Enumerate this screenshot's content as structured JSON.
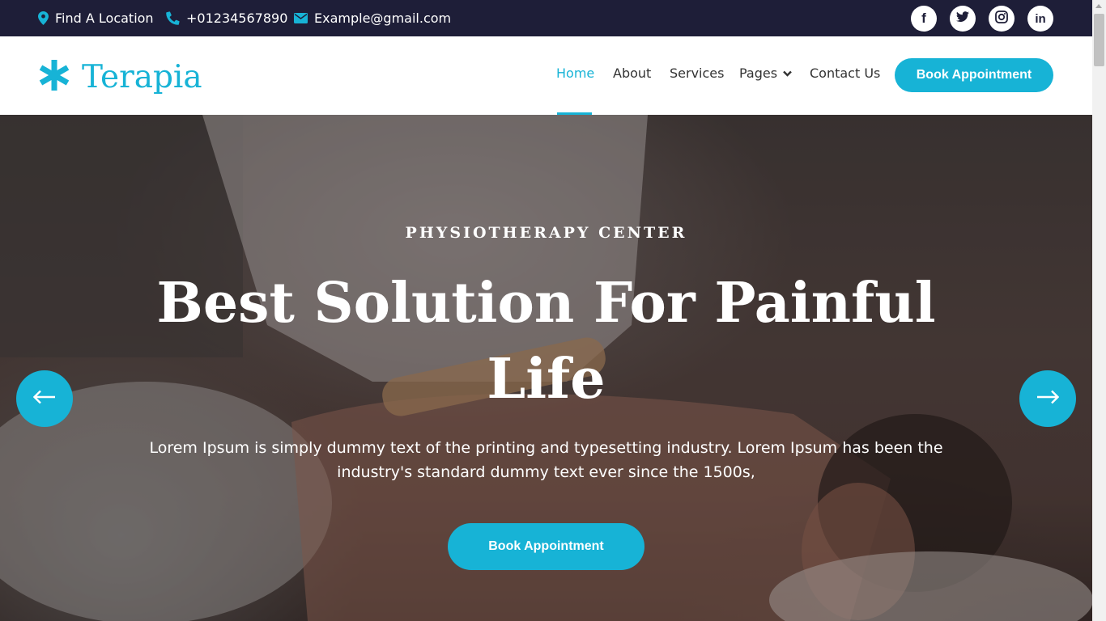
{
  "topbar": {
    "location": "Find A Location",
    "phone": "+01234567890",
    "email": "Example@gmail.com",
    "social": {
      "facebook": "f",
      "twitter": "twitter-icon",
      "instagram": "instagram-icon",
      "linkedin": "in"
    }
  },
  "brand": {
    "name": "Terapia",
    "accent_color": "#17b3d6",
    "dark_color": "#1e1e38"
  },
  "nav": {
    "items": [
      "Home",
      "About",
      "Services",
      "Pages",
      "Contact Us"
    ],
    "active": "Home",
    "cta": "Book Appointment"
  },
  "hero": {
    "subtitle": "PHYSIOTHERAPY CENTER",
    "title": "Best Solution For Painful Life",
    "description": "Lorem Ipsum is simply dummy text of the printing and typesetting industry. Lorem Ipsum has been the industry's standard dummy text ever since the 1500s,",
    "cta": "Book Appointment"
  }
}
